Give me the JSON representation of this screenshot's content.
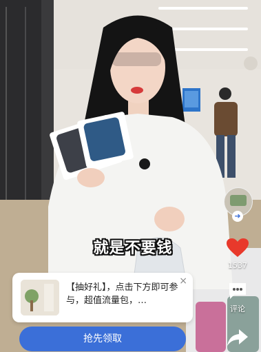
{
  "caption": "就是不要钱",
  "side_actions": {
    "like_count": "1537",
    "comment_label": "评论"
  },
  "promo": {
    "text": "【抽好礼】，点击下方即可参与，超值流量包，…",
    "close_label": "×",
    "cta_label": "抢先领取"
  },
  "colors": {
    "like_red": "#e8392b",
    "cta_blue": "#3b6fd8"
  },
  "icons": [
    "heart-icon",
    "comment-icon",
    "share-icon",
    "close-icon",
    "arrow-right-icon"
  ]
}
